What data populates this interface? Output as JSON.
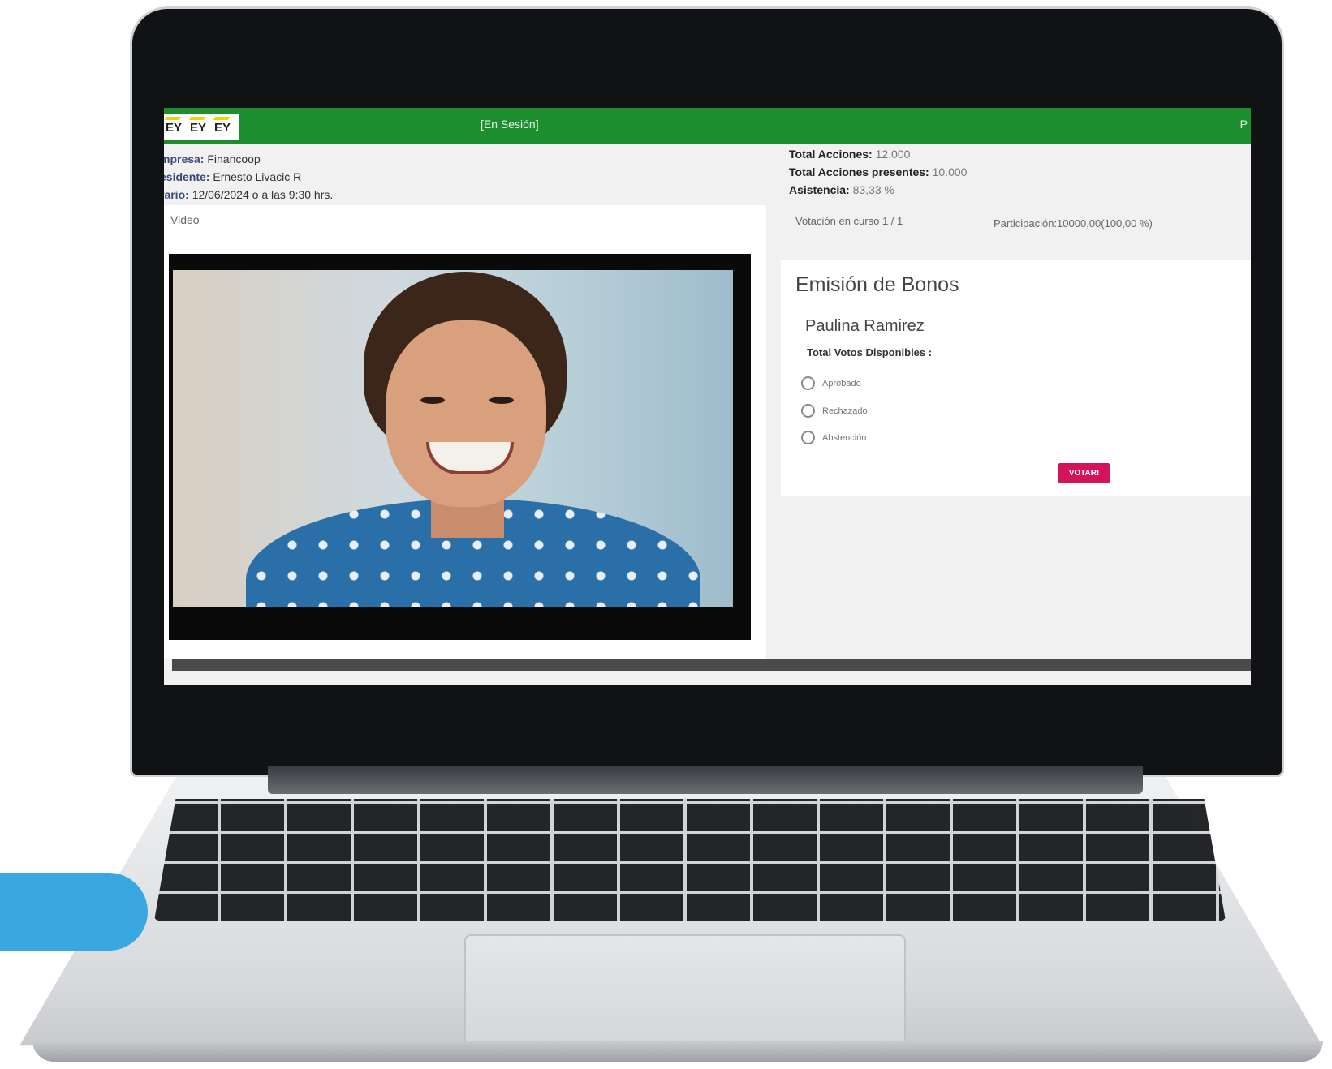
{
  "app": {
    "logos": [
      "EY",
      "EY",
      "EY"
    ],
    "session_status": "[En Sesión]",
    "top_right_fragment": "P"
  },
  "meeting": {
    "empresa_label": "mpresa:",
    "empresa": "Financoop",
    "presidente_label": "esidente:",
    "presidente": "Ernesto Livacic R",
    "horario_label": "rario:",
    "horario": "12/06/2024 o a las 9:30 hrs."
  },
  "stats": {
    "total_acciones_label": "Total Acciones:",
    "total_acciones": "12.000",
    "presentes_label": "Total Acciones presentes:",
    "presentes": "10.000",
    "asistencia_label": "Asistencia:",
    "asistencia": "83,33 %"
  },
  "video": {
    "header": "Video"
  },
  "vote": {
    "progress": "Votación en curso 1 / 1",
    "participation": "Participación:10000,00(100,00 %)",
    "title": "Emisión de Bonos",
    "voter": "Paulina Ramirez",
    "total_label": "Total Votos Disponibles :",
    "options": [
      "Aprobado",
      "Rechazado",
      "Abstención"
    ],
    "button": "VOTAR!"
  },
  "colors": {
    "topbar": "#1c8e2f",
    "vote_button": "#d4145a",
    "accent_tab": "#3aa8e0"
  }
}
